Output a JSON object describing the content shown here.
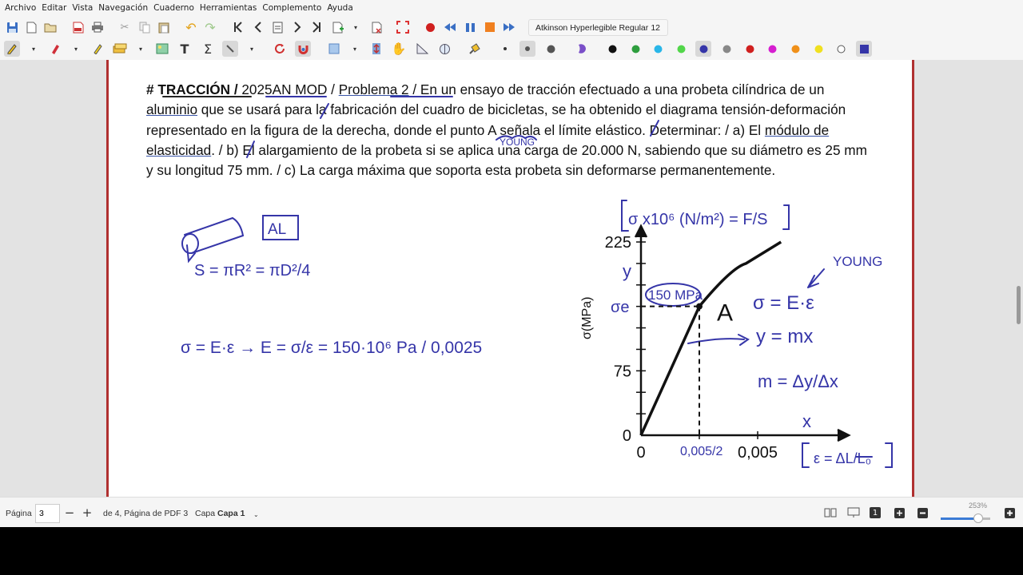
{
  "menu": [
    "Archivo",
    "Editar",
    "Vista",
    "Navegación",
    "Cuaderno",
    "Herramientas",
    "Complemento",
    "Ayuda"
  ],
  "toolbar": {
    "font_name": "Atkinson Hyperlegible Regular",
    "font_size": "12",
    "icons_row1": [
      "save-icon",
      "new-page-icon",
      "open-folder-icon",
      "export-pdf-icon",
      "print-icon",
      "cut-icon",
      "copy-icon",
      "paste-icon",
      "undo-icon",
      "redo-icon",
      "go-first-icon",
      "go-back-icon",
      "goto-page-icon",
      "go-next-icon",
      "go-last-icon",
      "insert-page-icon",
      "delete-page-icon",
      "fullscreen-icon",
      "record-icon",
      "rewind-icon",
      "pause-icon",
      "stop-icon",
      "fast-forward-icon"
    ],
    "icons_row2": [
      "pen-icon",
      "eraser-icon",
      "highlighter-icon",
      "select-region-icon",
      "image-icon",
      "text-icon",
      "tex-icon",
      "ruler-icon",
      "rotate-icon",
      "magnet-icon",
      "shape-icon",
      "vertical-space-icon",
      "hand-icon",
      "triangle-ruler-icon",
      "compass-icon",
      "fill-icon"
    ],
    "colors": [
      "#111111",
      "#2e9e3e",
      "#29b6e8",
      "#52d64a",
      "#3535a8",
      "#888888",
      "#d0201f",
      "#d61fd0",
      "#f0901a",
      "#f0e020",
      "#ffffff",
      "#3535a8"
    ]
  },
  "document": {
    "heading": "# TRACCIÓN / ",
    "tag": "2025AN MOD",
    "separator": " / ",
    "problem_label": "Problema 2",
    "text_1": " / En un ensayo de tracción efectuado a una probeta cilíndrica de un ",
    "aluminio": "aluminio",
    "text_2": " que se usará para la fabricación del cuadro de bicicletas, se ha obtenido el diagrama tensión-deformación representado en la figura de la derecha, donde el punto A señala el límite elástico. Determinar: / a) El ",
    "modulo": "módulo de elasticidad",
    "text_3": ". / b) El alargamiento de la probeta si se aplica una carga de 20.000 N, sabiendo que su diámetro es 25 mm y su longitud 75 mm. / c) La carga máxima que soporta esta probeta sin deformarse permanentemente."
  },
  "chart_data": {
    "type": "line",
    "ylabel": "σ(MPa)",
    "yticks": [
      "225",
      "75",
      "0"
    ],
    "xticks": [
      "0",
      "0,005"
    ],
    "point_label": "A",
    "series": [
      {
        "x": [
          0,
          0.0025
        ],
        "y": [
          0,
          150
        ]
      },
      {
        "x": [
          0.0025,
          0.0045,
          0.006
        ],
        "y": [
          150,
          200,
          225
        ]
      }
    ],
    "ylim": [
      0,
      225
    ]
  },
  "annotations": {
    "young_top": "YOUNG",
    "al_box": "AL",
    "area_formula": "S = πR² = πD²/4",
    "hooke": "σ = E·ε → E = σ/ε = 150·10⁶ Pa / 0,0025",
    "stress_units": "σ x10⁶ (N/m²) = F/S",
    "young_side": "YOUNG",
    "hooke_side": "σ = E·ε",
    "line_eq": "y = mx",
    "slope": "m = Δy/Δx",
    "sigma_e": "σe",
    "y_axis": "y",
    "x_axis": "x",
    "mpa_value": "150 MPa",
    "strain_formula": "ε = ΔL/L₀",
    "half_strain": "0,005/2"
  },
  "status": {
    "page_label": "Página",
    "page_value": "3",
    "page_of": "de 4, Página de PDF 3",
    "layer_label": "Capa",
    "layer_value": "Capa 1",
    "zoom": "253%"
  }
}
